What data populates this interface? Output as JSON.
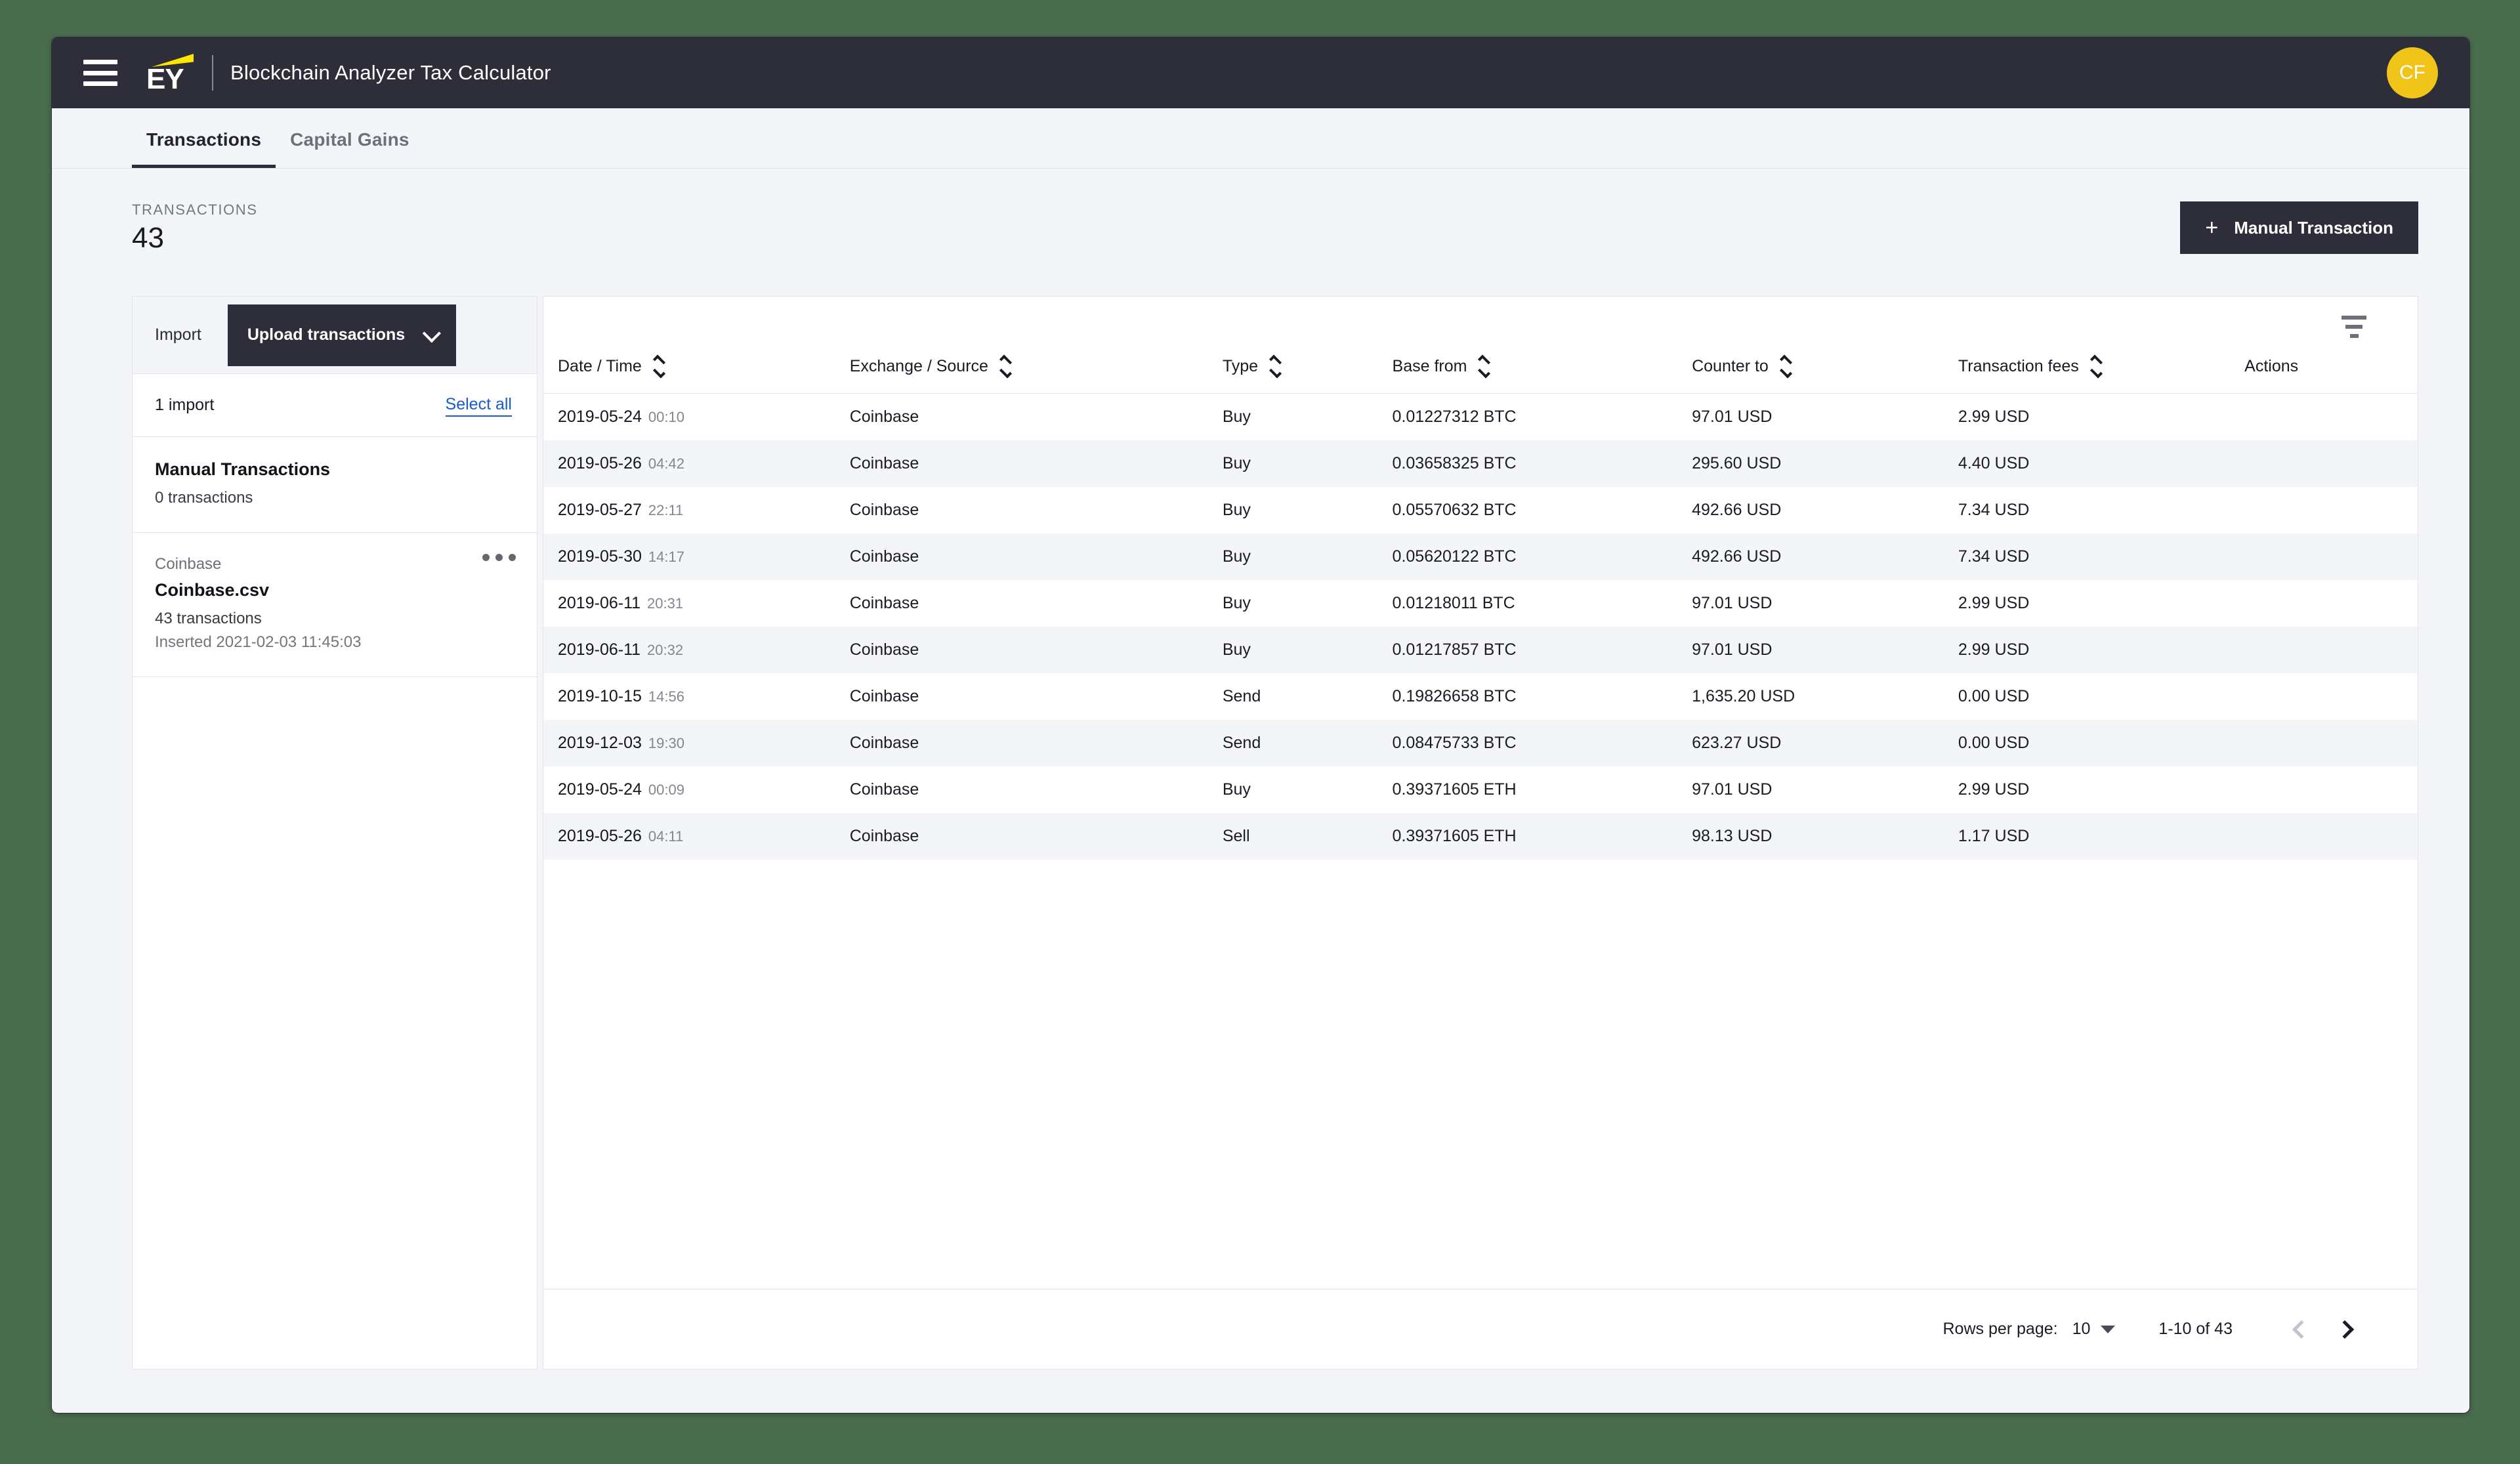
{
  "header": {
    "menu_icon": "hamburger-icon",
    "logo_text": "EY",
    "app_title": "Blockchain Analyzer Tax Calculator",
    "avatar_initials": "CF",
    "avatar_color": "#f0c419"
  },
  "tabs": [
    {
      "label": "Transactions",
      "active": true
    },
    {
      "label": "Capital Gains",
      "active": false
    }
  ],
  "page": {
    "overline": "TRANSACTIONS",
    "count": "43",
    "manual_button": "Manual Transaction",
    "manual_button_icon": "plus-icon"
  },
  "sidebar": {
    "import_label": "Import",
    "upload_button": "Upload transactions",
    "upload_button_icon": "chevron-down-icon",
    "import_count": "1 import",
    "select_all": "Select all",
    "items": [
      {
        "exchange": "",
        "name": "Manual Transactions",
        "transactions": "0 transactions",
        "inserted": ""
      },
      {
        "exchange": "Coinbase",
        "name": "Coinbase.csv",
        "transactions": "43 transactions",
        "inserted": "Inserted 2021-02-03 11:45:03"
      }
    ],
    "overflow_icon": "ellipsis-icon"
  },
  "table": {
    "filter_icon": "filter-icon",
    "columns": [
      {
        "label": "Date / Time",
        "sortable": true
      },
      {
        "label": "Exchange / Source",
        "sortable": true
      },
      {
        "label": "Type",
        "sortable": true
      },
      {
        "label": "Base from",
        "sortable": true
      },
      {
        "label": "Counter to",
        "sortable": true
      },
      {
        "label": "Transaction fees",
        "sortable": true
      },
      {
        "label": "Actions",
        "sortable": false
      }
    ],
    "rows": [
      {
        "date": "2019-05-24",
        "time": "00:10",
        "exchange": "Coinbase",
        "type": "Buy",
        "base": "0.01227312 BTC",
        "counter": "97.01 USD",
        "fees": "2.99 USD"
      },
      {
        "date": "2019-05-26",
        "time": "04:42",
        "exchange": "Coinbase",
        "type": "Buy",
        "base": "0.03658325 BTC",
        "counter": "295.60 USD",
        "fees": "4.40 USD"
      },
      {
        "date": "2019-05-27",
        "time": "22:11",
        "exchange": "Coinbase",
        "type": "Buy",
        "base": "0.05570632 BTC",
        "counter": "492.66 USD",
        "fees": "7.34 USD"
      },
      {
        "date": "2019-05-30",
        "time": "14:17",
        "exchange": "Coinbase",
        "type": "Buy",
        "base": "0.05620122 BTC",
        "counter": "492.66 USD",
        "fees": "7.34 USD"
      },
      {
        "date": "2019-06-11",
        "time": "20:31",
        "exchange": "Coinbase",
        "type": "Buy",
        "base": "0.01218011 BTC",
        "counter": "97.01 USD",
        "fees": "2.99 USD"
      },
      {
        "date": "2019-06-11",
        "time": "20:32",
        "exchange": "Coinbase",
        "type": "Buy",
        "base": "0.01217857 BTC",
        "counter": "97.01 USD",
        "fees": "2.99 USD"
      },
      {
        "date": "2019-10-15",
        "time": "14:56",
        "exchange": "Coinbase",
        "type": "Send",
        "base": "0.19826658 BTC",
        "counter": "1,635.20 USD",
        "fees": "0.00 USD"
      },
      {
        "date": "2019-12-03",
        "time": "19:30",
        "exchange": "Coinbase",
        "type": "Send",
        "base": "0.08475733 BTC",
        "counter": "623.27 USD",
        "fees": "0.00 USD"
      },
      {
        "date": "2019-05-24",
        "time": "00:09",
        "exchange": "Coinbase",
        "type": "Buy",
        "base": "0.39371605 ETH",
        "counter": "97.01 USD",
        "fees": "2.99 USD"
      },
      {
        "date": "2019-05-26",
        "time": "04:11",
        "exchange": "Coinbase",
        "type": "Sell",
        "base": "0.39371605 ETH",
        "counter": "98.13 USD",
        "fees": "1.17 USD"
      }
    ],
    "footer": {
      "rows_per_page_label": "Rows per page:",
      "rows_per_page_value": "10",
      "range": "1-10 of 43",
      "prev_icon": "chevron-left-icon",
      "next_icon": "chevron-right-icon"
    }
  }
}
